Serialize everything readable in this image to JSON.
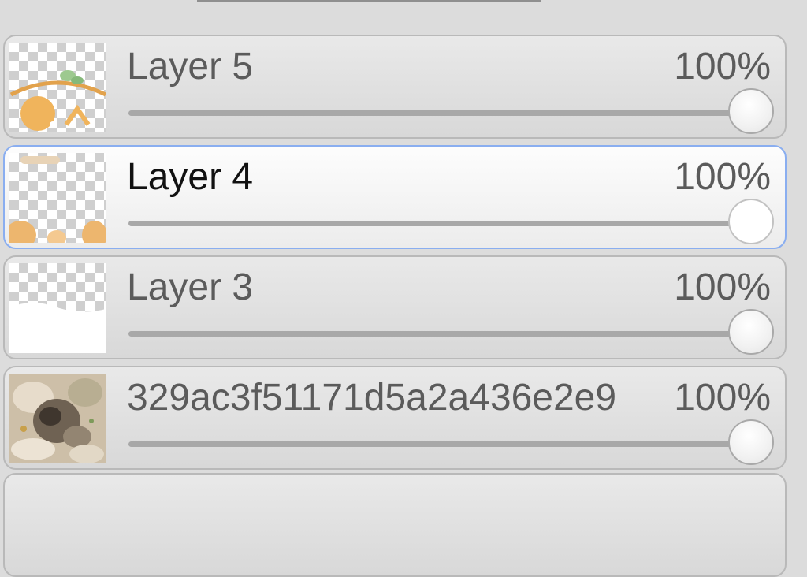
{
  "layers": [
    {
      "name": "Layer 5",
      "opacity_label": "100%",
      "opacity_value": 1.0,
      "selected": false,
      "thumb_icon": "orange-drawing-thumbnail"
    },
    {
      "name": "Layer 4",
      "opacity_label": "100%",
      "opacity_value": 1.0,
      "selected": true,
      "thumb_icon": "orange-blobs-thumbnail"
    },
    {
      "name": "Layer 3",
      "opacity_label": "100%",
      "opacity_value": 1.0,
      "selected": false,
      "thumb_icon": "white-fill-thumbnail"
    },
    {
      "name": "329ac3f51171d5a2a436e2e9",
      "opacity_label": "100%",
      "opacity_value": 1.0,
      "selected": false,
      "thumb_icon": "photo-thumbnail"
    }
  ],
  "colors": {
    "selected_border": "#8aaef0",
    "slider_track": "#a8a8a8"
  }
}
